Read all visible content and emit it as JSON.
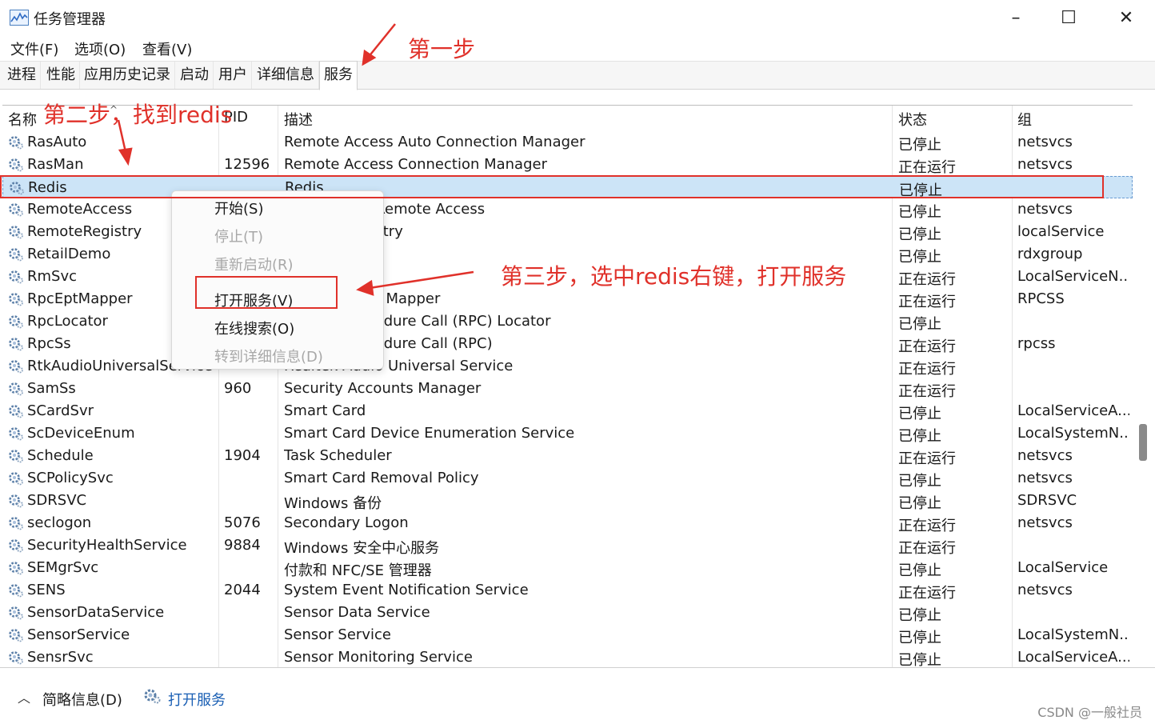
{
  "window": {
    "title": "任务管理器",
    "minimize": "–",
    "maximize": "☐",
    "close": "✕"
  },
  "menu": [
    "文件(F)",
    "选项(O)",
    "查看(V)"
  ],
  "tabs": [
    "进程",
    "性能",
    "应用历史记录",
    "启动",
    "用户",
    "详细信息",
    "服务"
  ],
  "columns": {
    "name": "名称",
    "pid": "PID",
    "desc": "描述",
    "status": "状态",
    "group": "组"
  },
  "rows": [
    {
      "name": "RasAuto",
      "pid": "",
      "desc": "Remote Access Auto Connection Manager",
      "status": "已停止",
      "group": "netsvcs"
    },
    {
      "name": "RasMan",
      "pid": "12596",
      "desc": "Remote Access Connection Manager",
      "status": "正在运行",
      "group": "netsvcs"
    },
    {
      "name": "Redis",
      "pid": "",
      "desc": "Redis",
      "status": "已停止",
      "group": ""
    },
    {
      "name": "RemoteAccess",
      "pid": "",
      "desc": "Routing and Remote Access",
      "status": "已停止",
      "group": "netsvcs"
    },
    {
      "name": "RemoteRegistry",
      "pid": "",
      "desc": "Remote Registry",
      "status": "已停止",
      "group": "localService"
    },
    {
      "name": "RetailDemo",
      "pid": "",
      "desc": "",
      "status": "已停止",
      "group": "rdxgroup"
    },
    {
      "name": "RmSvc",
      "pid": "",
      "desc": "",
      "status": "正在运行",
      "group": "LocalServiceN..."
    },
    {
      "name": "RpcEptMapper",
      "pid": "",
      "desc": "RPC Endpoint Mapper",
      "status": "正在运行",
      "group": "RPCSS"
    },
    {
      "name": "RpcLocator",
      "pid": "",
      "desc": "Remote Procedure Call (RPC) Locator",
      "status": "已停止",
      "group": ""
    },
    {
      "name": "RpcSs",
      "pid": "",
      "desc": "Remote Procedure Call (RPC)",
      "status": "正在运行",
      "group": "rpcss"
    },
    {
      "name": "RtkAudioUniversalService",
      "pid": "",
      "desc": "Realtek Audio Universal Service",
      "status": "正在运行",
      "group": ""
    },
    {
      "name": "SamSs",
      "pid": "960",
      "desc": "Security Accounts Manager",
      "status": "正在运行",
      "group": ""
    },
    {
      "name": "SCardSvr",
      "pid": "",
      "desc": "Smart Card",
      "status": "已停止",
      "group": "LocalServiceA..."
    },
    {
      "name": "ScDeviceEnum",
      "pid": "",
      "desc": "Smart Card Device Enumeration Service",
      "status": "已停止",
      "group": "LocalSystemN..."
    },
    {
      "name": "Schedule",
      "pid": "1904",
      "desc": "Task Scheduler",
      "status": "正在运行",
      "group": "netsvcs"
    },
    {
      "name": "SCPolicySvc",
      "pid": "",
      "desc": "Smart Card Removal Policy",
      "status": "已停止",
      "group": "netsvcs"
    },
    {
      "name": "SDRSVC",
      "pid": "",
      "desc": "Windows 备份",
      "status": "已停止",
      "group": "SDRSVC"
    },
    {
      "name": "seclogon",
      "pid": "5076",
      "desc": "Secondary Logon",
      "status": "正在运行",
      "group": "netsvcs"
    },
    {
      "name": "SecurityHealthService",
      "pid": "9884",
      "desc": "Windows 安全中心服务",
      "status": "正在运行",
      "group": ""
    },
    {
      "name": "SEMgrSvc",
      "pid": "",
      "desc": "付款和 NFC/SE 管理器",
      "status": "已停止",
      "group": "LocalService"
    },
    {
      "name": "SENS",
      "pid": "2044",
      "desc": "System Event Notification Service",
      "status": "正在运行",
      "group": "netsvcs"
    },
    {
      "name": "SensorDataService",
      "pid": "",
      "desc": "Sensor Data Service",
      "status": "已停止",
      "group": ""
    },
    {
      "name": "SensorService",
      "pid": "",
      "desc": "Sensor Service",
      "status": "已停止",
      "group": "LocalSystemN..."
    },
    {
      "name": "SensrSvc",
      "pid": "",
      "desc": "Sensor Monitoring Service",
      "status": "已停止",
      "group": "LocalServiceA..."
    }
  ],
  "context_menu": [
    {
      "label": "开始(S)",
      "disabled": false
    },
    {
      "label": "停止(T)",
      "disabled": true
    },
    {
      "label": "重新启动(R)",
      "disabled": true
    },
    {
      "label": "打开服务(V)",
      "disabled": false
    },
    {
      "label": "在线搜索(O)",
      "disabled": false
    },
    {
      "label": "转到详细信息(D)",
      "disabled": true
    }
  ],
  "bottom": {
    "fewer_details": "简略信息(D)",
    "open_services": "打开服务"
  },
  "annotations": {
    "step1": "第一步",
    "step2": "第二步，找到redis",
    "step3": "第三步，选中redis右键，打开服务"
  },
  "watermark": "CSDN @一般社员",
  "colors": {
    "annotation": "#e0312a",
    "selection": "#cce4f7",
    "link": "#1a5fb4"
  }
}
